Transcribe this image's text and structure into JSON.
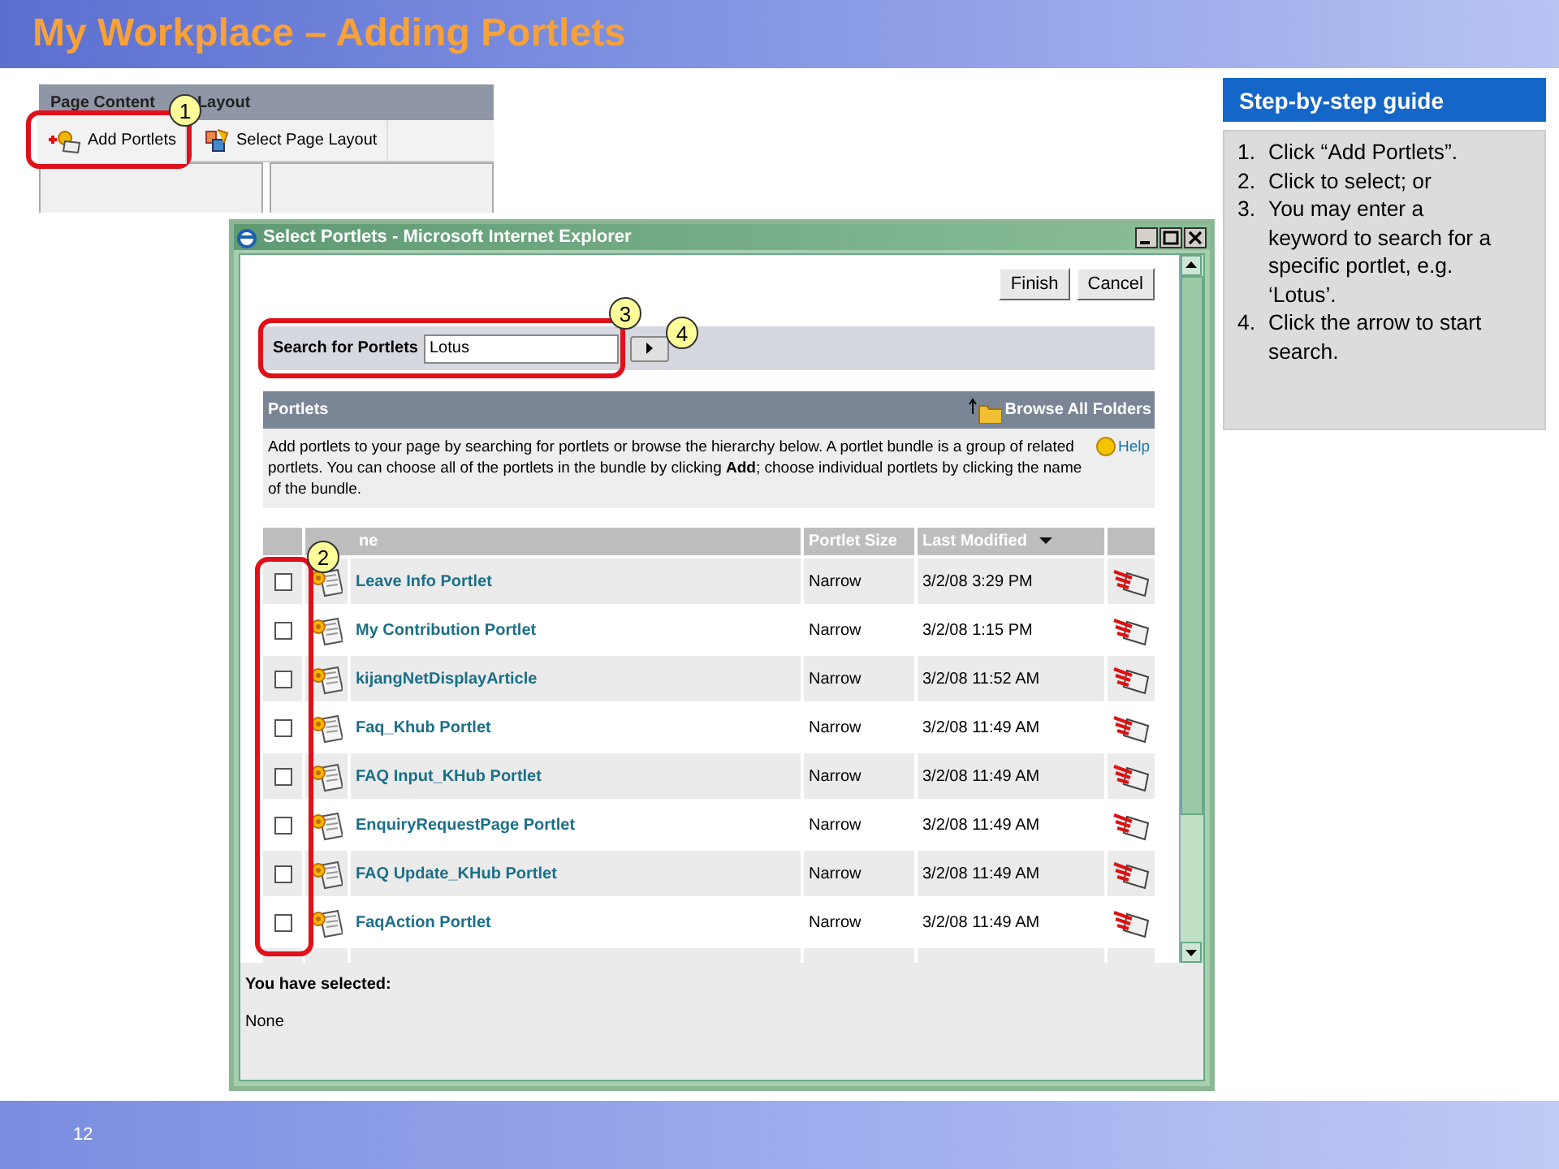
{
  "slide": {
    "title": "My Workplace – Adding Portlets",
    "page_number": "12"
  },
  "toolbar": {
    "header_parts": [
      "Page Content",
      "Layout"
    ],
    "callout": "1",
    "buttons": [
      {
        "label": "Add Portlets",
        "kind": "add",
        "highlighted": true
      },
      {
        "label": "Select Page Layout",
        "kind": "layout",
        "highlighted": false
      }
    ]
  },
  "dialog": {
    "title": "Select Portlets - Microsoft Internet Explorer",
    "buttons": [
      "Finish",
      "Cancel"
    ],
    "search": {
      "label": "Search for Portlets",
      "value": "Lotus",
      "callout": "3",
      "go_callout": "4"
    },
    "panel": {
      "title": "Portlets",
      "browse_link": "Browse All Folders",
      "description": "Add portlets to your page by searching for portlets or browse the hierarchy below. A portlet bundle is a group of related portlets. You can choose all of the portlets in the bundle by clicking **Add**; choose individual portlets by clicking the name of the bundle.",
      "help_link": "Help"
    },
    "table": {
      "callout": "2",
      "columns": [
        "ne",
        "Portlet Size",
        "Last Modified"
      ],
      "rows": [
        {
          "checked": false,
          "name": "Leave Info Portlet",
          "size": "Narrow",
          "modified": "3/2/08 3:29 PM"
        },
        {
          "checked": false,
          "name": "My Contribution Portlet",
          "size": "Narrow",
          "modified": "3/2/08 1:15 PM"
        },
        {
          "checked": false,
          "name": "kijangNetDisplayArticle",
          "size": "Narrow",
          "modified": "3/2/08 11:52 AM"
        },
        {
          "checked": false,
          "name": "Faq_Khub Portlet",
          "size": "Narrow",
          "modified": "3/2/08 11:49 AM"
        },
        {
          "checked": false,
          "name": "FAQ Input_KHub Portlet",
          "size": "Narrow",
          "modified": "3/2/08 11:49 AM"
        },
        {
          "checked": false,
          "name": "EnquiryRequestPage Portlet",
          "size": "Narrow",
          "modified": "3/2/08 11:49 AM"
        },
        {
          "checked": false,
          "name": "FAQ Update_KHub Portlet",
          "size": "Narrow",
          "modified": "3/2/08 11:49 AM"
        },
        {
          "checked": false,
          "name": "FaqAction Portlet",
          "size": "Narrow",
          "modified": "3/2/08 11:49 AM"
        }
      ]
    },
    "selection": {
      "label": "You have selected:",
      "value": "None"
    }
  },
  "guide": {
    "title": "Step-by-step guide",
    "steps": [
      {
        "number": "1.",
        "text": "Click “Add Portlets”."
      },
      {
        "number": "2.",
        "text": "Click to select; or"
      },
      {
        "number": "3.",
        "text": "You may enter a keyword to search for a specific portlet, e.g. ‘Lotus’."
      },
      {
        "number": "4.",
        "text": "Click the arrow to start search."
      }
    ]
  }
}
